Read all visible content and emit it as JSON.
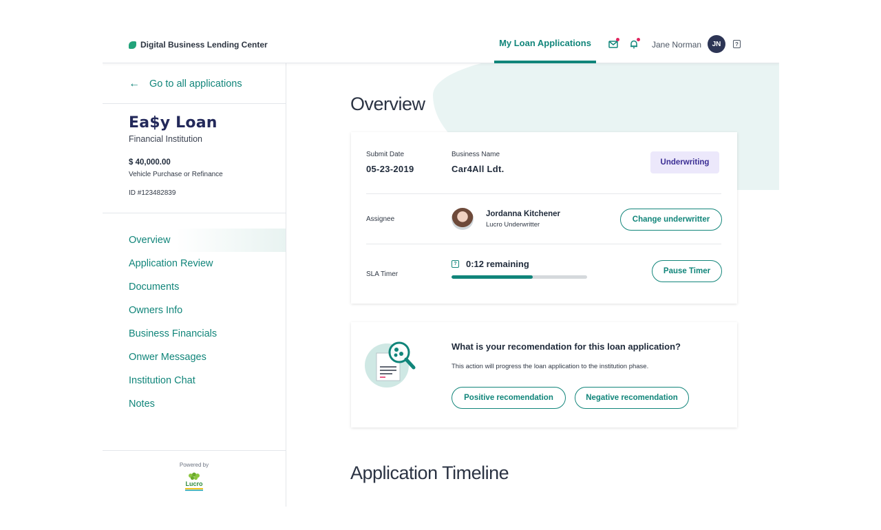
{
  "header": {
    "brand": "Digital Business Lending Center",
    "nav_tab": "My Loan Applications",
    "user_name": "Jane Norman",
    "user_initials": "JN"
  },
  "sidebar": {
    "back_label": "Go to all applications",
    "lender_name": "Ea$y Loan",
    "lender_type": "Financial Institution",
    "amount": "$ 40,000.00",
    "purpose": "Vehicle Purchase or Refinance",
    "application_id": "ID #123482839",
    "menu": [
      {
        "label": "Overview",
        "active": true
      },
      {
        "label": "Application Review"
      },
      {
        "label": "Documents"
      },
      {
        "label": "Owners Info"
      },
      {
        "label": "Business Financials"
      },
      {
        "label": "Onwer Messages"
      },
      {
        "label": "Institution Chat"
      },
      {
        "label": "Notes"
      }
    ],
    "powered_by": "Powered by",
    "powered_logo_text": "Lucro"
  },
  "main": {
    "overview_title": "Overview",
    "submit_date_label": "Submit Date",
    "submit_date": "05-23-2019",
    "business_name_label": "Business Name",
    "business_name": "Car4All Ldt.",
    "status_badge": "Underwriting",
    "assignee_label": "Assignee",
    "assignee_name": "Jordanna Kitchener",
    "assignee_role": "Lucro Underwritter",
    "change_button": "Change underwritter",
    "sla_label": "SLA Timer",
    "sla_remaining": "0:12 remaining",
    "sla_progress": 0.6,
    "pause_button": "Pause Timer",
    "recommendation_question": "What is your recomendation for this loan application?",
    "recommendation_note": "This action will progress the loan application to the institution phase.",
    "positive_button": "Positive recomendation",
    "negative_button": "Negative recomendation",
    "timeline_title": "Application Timeline"
  },
  "colors": {
    "accent": "#11857a",
    "badge_bg": "#ece8fb",
    "badge_text": "#3b2e94",
    "notification_dot": "#e0245e",
    "avatar_bg": "#2d3555"
  }
}
